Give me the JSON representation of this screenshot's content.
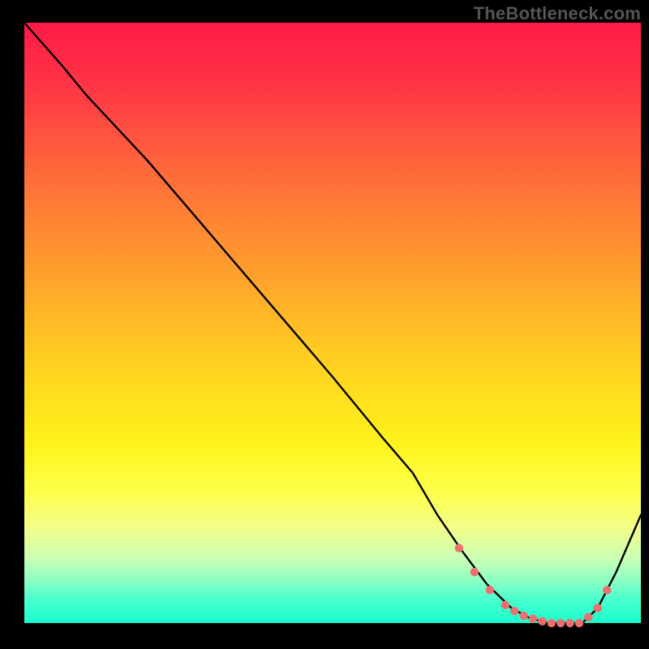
{
  "watermark": "TheBottleneck.com",
  "chart_data": {
    "type": "line",
    "title": "",
    "xlabel": "",
    "ylabel": "",
    "xlim": [
      0,
      100
    ],
    "ylim": [
      0,
      100
    ],
    "series": [
      {
        "name": "bottleneck-curve",
        "x": [
          0,
          6,
          10,
          20,
          30,
          40,
          50,
          58,
          63,
          67,
          71,
          75,
          79,
          82,
          85,
          88,
          90.5,
          93,
          96,
          100
        ],
        "y": [
          100,
          93,
          88,
          77,
          65,
          53,
          41,
          31,
          25,
          18,
          12,
          6.5,
          2.5,
          0.8,
          0,
          0,
          0,
          2.5,
          8.5,
          18
        ]
      }
    ],
    "markers": {
      "name": "highlight-region",
      "x": [
        70.5,
        73,
        75.5,
        78,
        79.5,
        81,
        82.5,
        84,
        85.5,
        87,
        88.5,
        90,
        91.5,
        93,
        94.5
      ],
      "y": [
        12.5,
        8.5,
        5.5,
        3,
        2,
        1.2,
        0.7,
        0.3,
        0,
        0,
        0,
        0,
        1,
        2.5,
        5.5
      ]
    },
    "annotations": []
  },
  "colors": {
    "curve": "#000000",
    "marker": "#ee6f6f",
    "plot_border_left": 30,
    "plot_border_right": 10,
    "plot_border_top": 28,
    "plot_border_bottom": 32
  }
}
